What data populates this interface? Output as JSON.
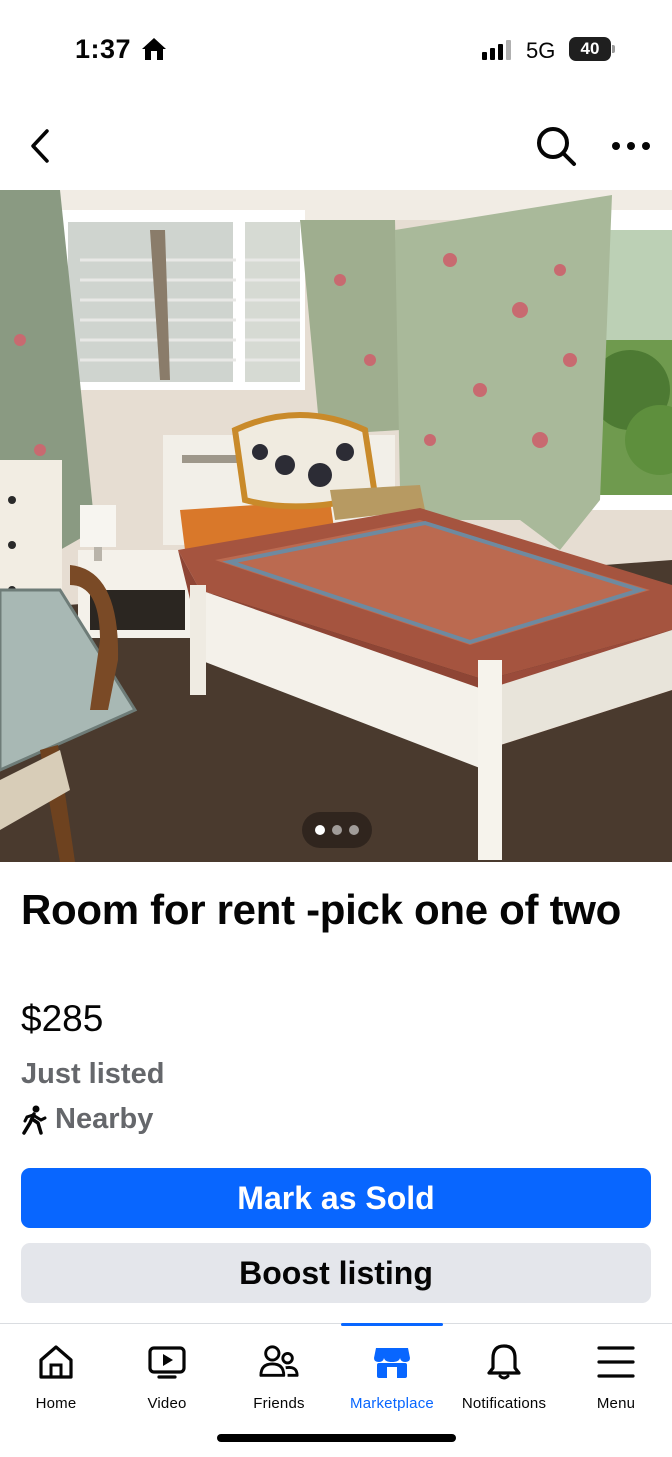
{
  "status_bar": {
    "time": "1:37",
    "network": "5G",
    "battery": "40"
  },
  "top_nav": {
    "back_icon": "chevron-left-icon",
    "search_icon": "search-icon",
    "more_icon": "more-horizontal-icon"
  },
  "photo": {
    "page_count": 3,
    "current_page": 1
  },
  "listing": {
    "title": "Room for rent -pick one of two",
    "price": "$285",
    "listed_status": "Just listed",
    "location": "Nearby",
    "location_icon": "walking-person-icon"
  },
  "actions": {
    "primary_label": "Mark as Sold",
    "secondary_label": "Boost listing"
  },
  "tabs": [
    {
      "label": "Home",
      "icon": "home-icon"
    },
    {
      "label": "Video",
      "icon": "video-play-icon"
    },
    {
      "label": "Friends",
      "icon": "friends-icon"
    },
    {
      "label": "Marketplace",
      "icon": "marketplace-icon",
      "active": true
    },
    {
      "label": "Notifications",
      "icon": "bell-icon"
    },
    {
      "label": "Menu",
      "icon": "hamburger-menu-icon"
    }
  ],
  "colors": {
    "accent": "#0866ff",
    "secondary_button": "#e4e6eb",
    "muted_text": "#65676b"
  }
}
